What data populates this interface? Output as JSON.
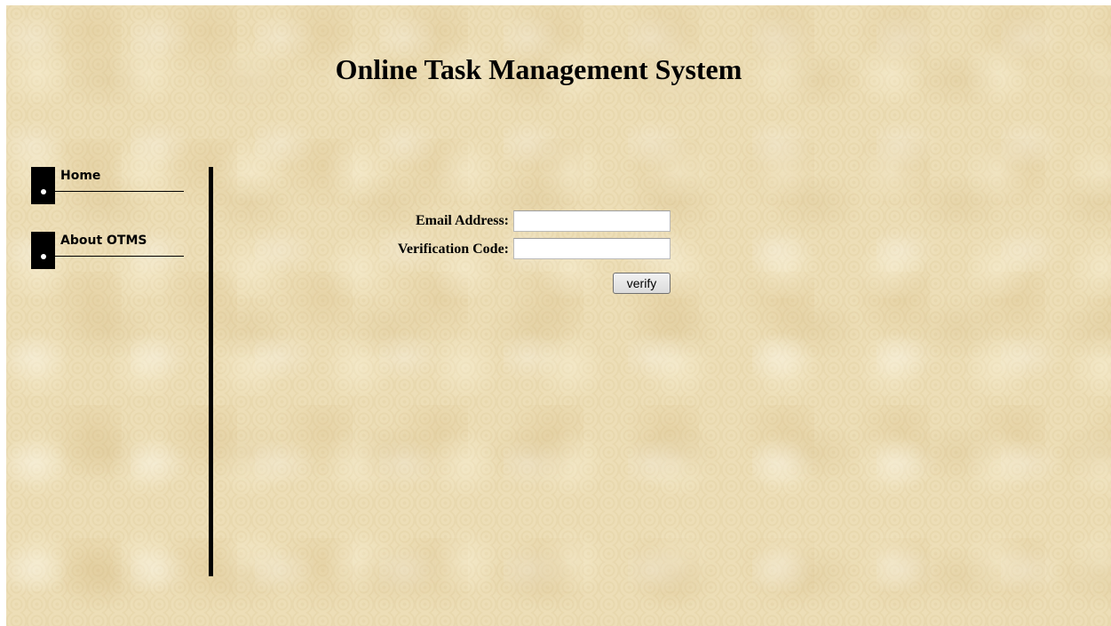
{
  "header": {
    "title": "Online Task Management System"
  },
  "sidebar": {
    "items": [
      {
        "label": "Home"
      },
      {
        "label": "About OTMS"
      }
    ]
  },
  "form": {
    "email_label": "Email Address:",
    "email_value": "",
    "code_label": "Verification Code:",
    "code_value": "",
    "verify_label": "verify"
  },
  "colors": {
    "background": "#ecdcb4",
    "text": "#000000",
    "nav_block": "#000000"
  }
}
